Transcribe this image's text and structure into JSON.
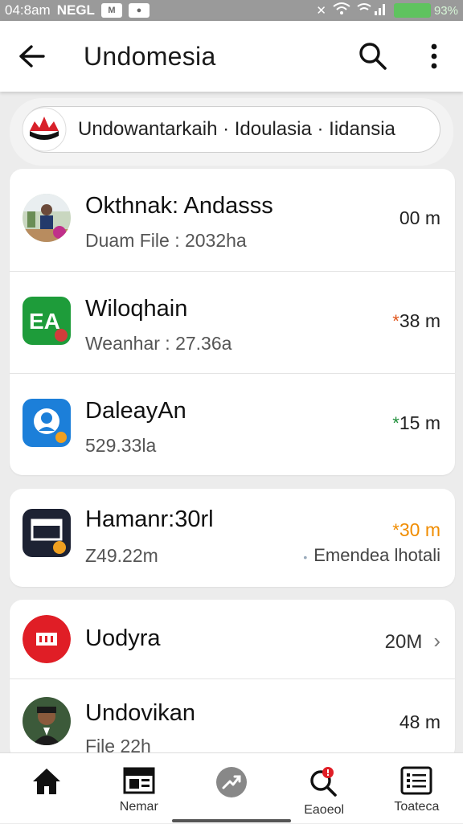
{
  "status_bar": {
    "time": "04:8am",
    "carrier": "NEGL",
    "battery_text": "93%"
  },
  "header": {
    "title": "Undomesia"
  },
  "breadcrumb": {
    "text": "Undowantarkaih · Idoulasia · Iidansia"
  },
  "cards": [
    {
      "rows": [
        {
          "title": "Okthnak: Andasss",
          "subtitle": "Duam File : 2032ha",
          "meta": "00 m",
          "star": "",
          "avatar": "photo-avatar"
        },
        {
          "title": "Wiloqhain",
          "subtitle": "Weanhar : 27.36a",
          "meta": "38 m",
          "star": "*",
          "star_color": "#e0551b",
          "avatar": "green-app-icon"
        },
        {
          "title": "DaleayAn",
          "subtitle": "529.33la",
          "meta": "15 m",
          "star": "*",
          "star_color": "#1f8f3a",
          "avatar": "blue-app-icon"
        }
      ]
    },
    {
      "rows": [
        {
          "title": "Hamanr:30rl",
          "subtitle": "Z49.22m",
          "meta": "30 m",
          "star": "*",
          "star_color": "#f08c00",
          "meta_color": "#f08c00",
          "extra": "Emendea lhotali",
          "avatar": "dark-app-icon"
        }
      ]
    },
    {
      "rows": [
        {
          "title": "Uodyra",
          "subtitle": "",
          "meta": "20M",
          "avatar": "red-app-icon"
        },
        {
          "title": "Undovikan",
          "subtitle": "File 22h",
          "meta": "48 m",
          "avatar": "person-photo"
        }
      ]
    }
  ],
  "bottom_nav": [
    {
      "label": "",
      "icon": "home-icon"
    },
    {
      "label": "Nemar",
      "icon": "news-icon"
    },
    {
      "label": "",
      "icon": "trending-icon"
    },
    {
      "label": "Eaoeol",
      "icon": "search-alert-icon"
    },
    {
      "label": "Toateca",
      "icon": "list-icon"
    }
  ]
}
